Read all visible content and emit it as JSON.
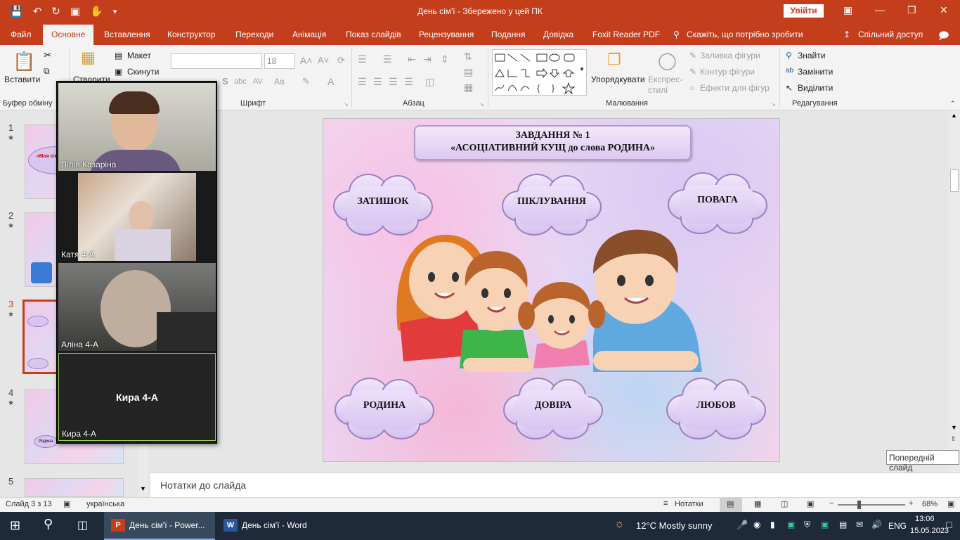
{
  "window": {
    "title": "День сім'ї  -  Збережено у цей ПК",
    "signin": "Увійти"
  },
  "tabs": [
    "Файл",
    "Основне",
    "Вставлення",
    "Конструктор",
    "Переходи",
    "Анімація",
    "Показ слайдів",
    "Рецензування",
    "Подання",
    "Довідка",
    "Foxit Reader PDF",
    "Скажіть, що потрібно зробити",
    "Спільний доступ"
  ],
  "ribbon": {
    "clipboard": {
      "paste": "Вставити",
      "label": "Буфер обміну"
    },
    "slides": {
      "new": "Створити",
      "layout": "Макет",
      "reset": "Скинути"
    },
    "font": {
      "label": "Шрифт",
      "size": "18"
    },
    "paragraph": {
      "label": "Абзац"
    },
    "drawing": {
      "arrange": "Упорядкувати",
      "quick_styles": "Експрес-стилі",
      "fill": "Заливка фігури",
      "outline": "Контур фігури",
      "effects": "Ефекти для фігур",
      "label": "Малювання"
    },
    "editing": {
      "find": "Знайти",
      "replace": "Замінити",
      "select": "Виділити",
      "label": "Редагування"
    }
  },
  "thumbnails": [
    {
      "num": "1",
      "text": "«Моя сім'я - моя"
    },
    {
      "num": "2",
      "text": ""
    },
    {
      "num": "3",
      "text": ""
    },
    {
      "num": "4",
      "text": "Родина"
    },
    {
      "num": "5",
      "text": ""
    }
  ],
  "slide": {
    "title_line1": "ЗАВДАННЯ № 1",
    "title_line2": "«АСОЦІАТИВНИЙ КУЩ  до слова РОДИНА»",
    "clouds": [
      "ЗАТИШОК",
      "ПІКЛУВАННЯ",
      "ПОВАГА",
      "РОДИНА",
      "ДОВІРА",
      "ЛЮБОВ"
    ]
  },
  "participants": [
    {
      "name": "Лілія Казаріна"
    },
    {
      "name": "Катя  4-А"
    },
    {
      "name": "Аліна 4-А"
    },
    {
      "name": "Кира 4-А",
      "center": "Кира 4-А"
    }
  ],
  "notes": {
    "placeholder": "Нотатки до слайда"
  },
  "tooltip": "Попередній слайд",
  "status": {
    "slide": "Слайд 3 з 13",
    "language": "українська",
    "notes": "Нотатки",
    "zoom": "68%"
  },
  "taskbar": {
    "apps": [
      "День сім'ї - Power...",
      "День сім'ї - Word"
    ],
    "weather": "12°C  Mostly sunny",
    "lang": "ENG",
    "time": "13:06",
    "date": "15.05.2023"
  }
}
